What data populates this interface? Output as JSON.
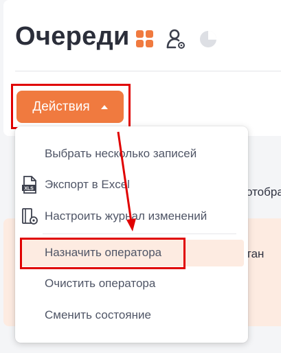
{
  "header": {
    "title": "Очереди"
  },
  "toolbar": {
    "actions_label": "Действия",
    "accent_color": "#f07a3f"
  },
  "background": {
    "snippet_right_top": "отобраз",
    "snippet_right_mid": "тан"
  },
  "menu": {
    "items": [
      {
        "label": "Выбрать несколько записей",
        "icon": ""
      },
      {
        "label": "Экспорт в Excel",
        "icon": "xls-file-icon"
      },
      {
        "label": "Настроить журнал изменений",
        "icon": "log-settings-icon"
      },
      {
        "label": "Назначить оператора",
        "icon": ""
      },
      {
        "label": "Очистить оператора",
        "icon": ""
      },
      {
        "label": "Сменить состояние",
        "icon": ""
      }
    ],
    "highlight_color": "#e00000"
  }
}
